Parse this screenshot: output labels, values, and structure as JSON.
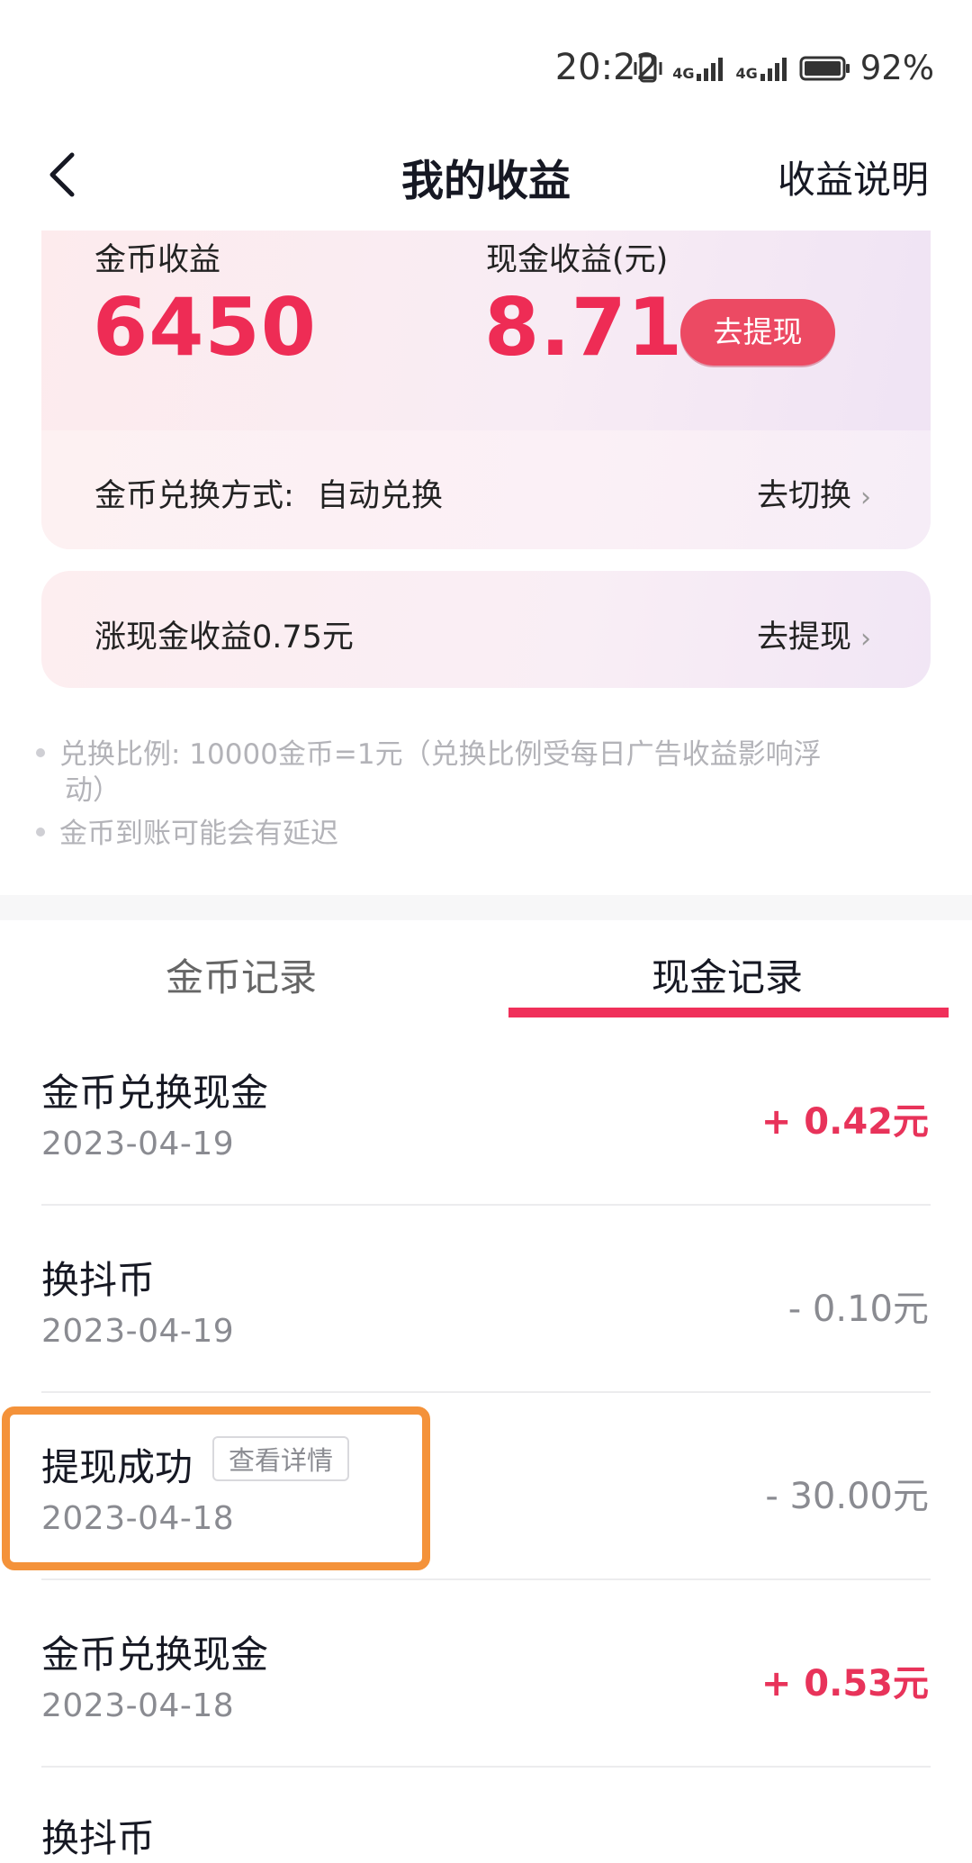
{
  "status_bar": {
    "time": "20:22",
    "network1": "4G",
    "network2": "4G",
    "battery": "92%",
    "icons": [
      "vibrate-icon",
      "signal-icon",
      "signal-icon",
      "battery-icon"
    ]
  },
  "nav": {
    "title": "我的收益",
    "right_link": "收益说明",
    "back_icon": "chevron-left-icon"
  },
  "earnings": {
    "coin_label": "金币收益",
    "coin_value": "6450",
    "cash_label": "现金收益(元)",
    "cash_value": "8.71",
    "withdraw_button": "去提现",
    "exchange_method_label": "金币兑换方式:",
    "exchange_method_value": "自动兑换",
    "switch_link": "去切换"
  },
  "promo": {
    "text": "涨现金收益0.75元",
    "link": "去提现"
  },
  "notes": {
    "line1": "兑换比例: 10000金币=1元（兑换比例受每日广告收益影响浮",
    "line1_cont": "动）",
    "line2": "金币到账可能会有延迟"
  },
  "tabs": [
    {
      "label": "金币记录",
      "active": false
    },
    {
      "label": "现金记录",
      "active": true
    }
  ],
  "records": [
    {
      "title": "金币兑换现金",
      "date": "2023-04-19",
      "amount": "+ 0.42元"
    },
    {
      "title": "换抖币",
      "date": "2023-04-19",
      "amount": "- 0.10元"
    },
    {
      "title": "提现成功",
      "tag": "查看详情",
      "date": "2023-04-18",
      "amount": "- 30.00元"
    },
    {
      "title": "金币兑换现金",
      "date": "2023-04-18",
      "amount": "+ 0.53元"
    },
    {
      "title": "换抖币"
    }
  ],
  "colors": {
    "accent": "#ee2c55",
    "highlight_box": "#f4923a"
  }
}
